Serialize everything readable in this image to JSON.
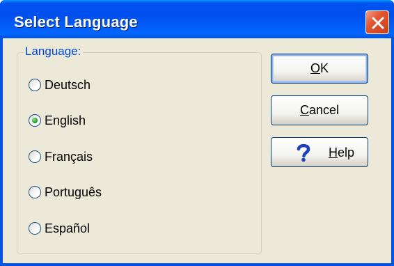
{
  "window": {
    "title": "Select Language"
  },
  "language_group": {
    "label": "Language:",
    "selected": "English",
    "options": [
      {
        "label": "Deutsch",
        "selected": false
      },
      {
        "label": "English",
        "selected": true
      },
      {
        "label": "Français",
        "selected": false
      },
      {
        "label": "Português",
        "selected": false
      },
      {
        "label": "Español",
        "selected": false
      }
    ]
  },
  "buttons": {
    "ok": {
      "mnemonic": "O",
      "rest": "K"
    },
    "cancel": {
      "mnemonic": "C",
      "rest": "ancel"
    },
    "help": {
      "mnemonic": "H",
      "rest": "elp"
    }
  },
  "icons": {
    "close": "close-icon",
    "help": "help-question-icon"
  },
  "colors": {
    "titlebar": "#0054e3",
    "client_bg": "#ece9d8",
    "group_label": "#0046d5",
    "close_button": "#e3552f",
    "radio_selected": "#21a121",
    "help_icon": "#1d3fbf"
  }
}
